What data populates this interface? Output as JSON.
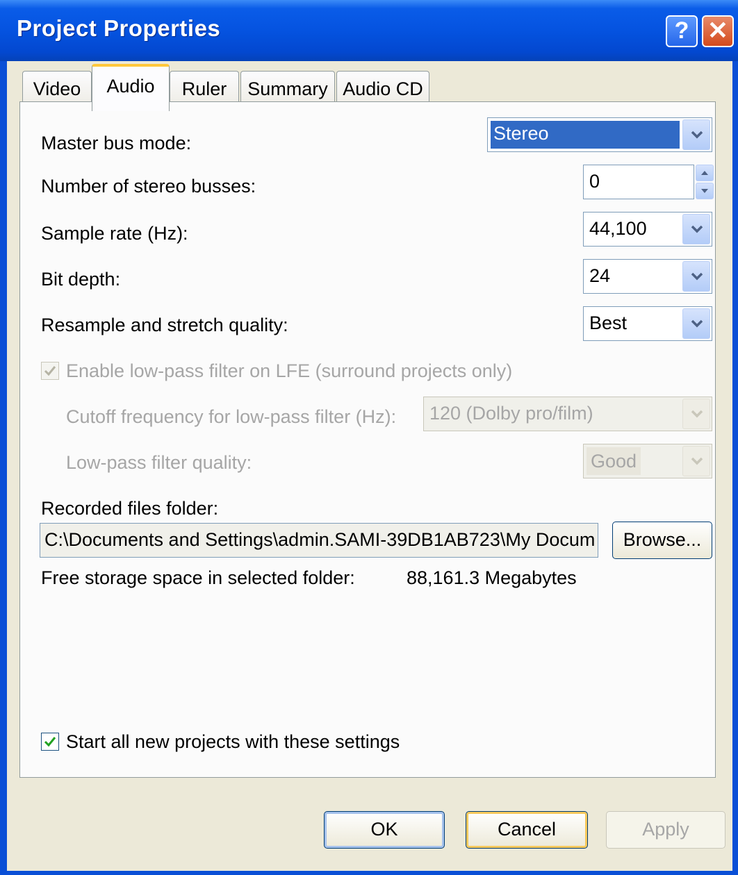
{
  "window": {
    "title": "Project Properties",
    "help_label": "?",
    "close_label": "✕"
  },
  "tabs": [
    {
      "label": "Video"
    },
    {
      "label": "Audio"
    },
    {
      "label": "Ruler"
    },
    {
      "label": "Summary"
    },
    {
      "label": "Audio CD"
    }
  ],
  "active_tab": "Audio",
  "audio": {
    "master_bus_mode": {
      "label": "Master bus mode:",
      "value": "Stereo"
    },
    "stereo_busses": {
      "label": "Number of stereo busses:",
      "value": "0"
    },
    "sample_rate": {
      "label": "Sample rate (Hz):",
      "value": "44,100"
    },
    "bit_depth": {
      "label": "Bit depth:",
      "value": "24"
    },
    "resample_quality": {
      "label": "Resample and stretch quality:",
      "value": "Best"
    },
    "lowpass_enable": {
      "label": "Enable low-pass filter on LFE (surround projects only)",
      "checked": true,
      "disabled": true
    },
    "cutoff": {
      "label": "Cutoff frequency for low-pass filter (Hz):",
      "value": "120 (Dolby pro/film)"
    },
    "lowpass_quality": {
      "label": "Low-pass filter quality:",
      "value": "Good"
    },
    "recorded_folder": {
      "label": "Recorded files folder:",
      "value": "C:\\Documents and Settings\\admin.SAMI-39DB1AB723\\My Docum",
      "browse_label": "Browse..."
    },
    "free_space": {
      "label": "Free storage space in selected folder:",
      "value": "88,161.3 Megabytes"
    },
    "start_new": {
      "label": "Start all new projects with these settings",
      "checked": true
    }
  },
  "buttons": {
    "ok": "OK",
    "cancel": "Cancel",
    "apply": "Apply"
  },
  "colors": {
    "titlebar": "#0553e0",
    "dialog_bg": "#ece9d8",
    "selection": "#316ac5",
    "active_tab_accent": "#ffc83c"
  }
}
